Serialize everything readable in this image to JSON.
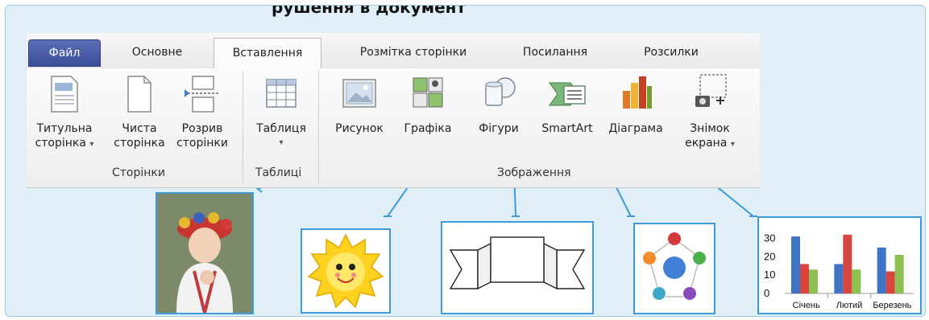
{
  "heading": "рушення в документ",
  "ribbon": {
    "tabs": [
      {
        "label": "Файл"
      },
      {
        "label": "Основне"
      },
      {
        "label": "Вставлення"
      },
      {
        "label": "Розмітка сторінки"
      },
      {
        "label": "Посилання"
      },
      {
        "label": "Розсилки"
      }
    ],
    "buttons": {
      "cover": {
        "line1": "Титульна",
        "line2": "сторінка",
        "caret": "▾"
      },
      "blank": {
        "line1": "Чиста",
        "line2": "сторінка"
      },
      "break": {
        "line1": "Розрив",
        "line2": "сторінки"
      },
      "table": {
        "line1": "Таблиця",
        "caret": "▾"
      },
      "picture": {
        "line1": "Рисунок"
      },
      "clipart": {
        "line1": "Графіка"
      },
      "shapes": {
        "line1": "Фігури"
      },
      "smartart": {
        "line1": "SmartArt"
      },
      "chart": {
        "line1": "Діаграма"
      },
      "screenshot": {
        "line1": "Знімок",
        "line2": "екрана",
        "caret": "▾"
      }
    },
    "groups": {
      "pages": "Сторінки",
      "tables": "Таблиці",
      "illustrations": "Зображення"
    }
  },
  "examples": {
    "chart": {
      "yticks": [
        "30",
        "20",
        "10",
        "0"
      ],
      "categories": [
        "Січень",
        "Лютий",
        "Березень"
      ]
    }
  },
  "chart_data": {
    "type": "bar",
    "categories": [
      "Січень",
      "Лютий",
      "Березень"
    ],
    "series": [
      {
        "values": [
          31,
          16,
          25
        ],
        "color": "#3f73c7"
      },
      {
        "values": [
          16,
          32,
          12
        ],
        "color": "#d9443f"
      },
      {
        "values": [
          13,
          13,
          21
        ],
        "color": "#8cc152"
      }
    ],
    "ylim": [
      0,
      35
    ]
  },
  "colors": {
    "accent": "#3c9bd8",
    "frame": "#dfeef7"
  }
}
